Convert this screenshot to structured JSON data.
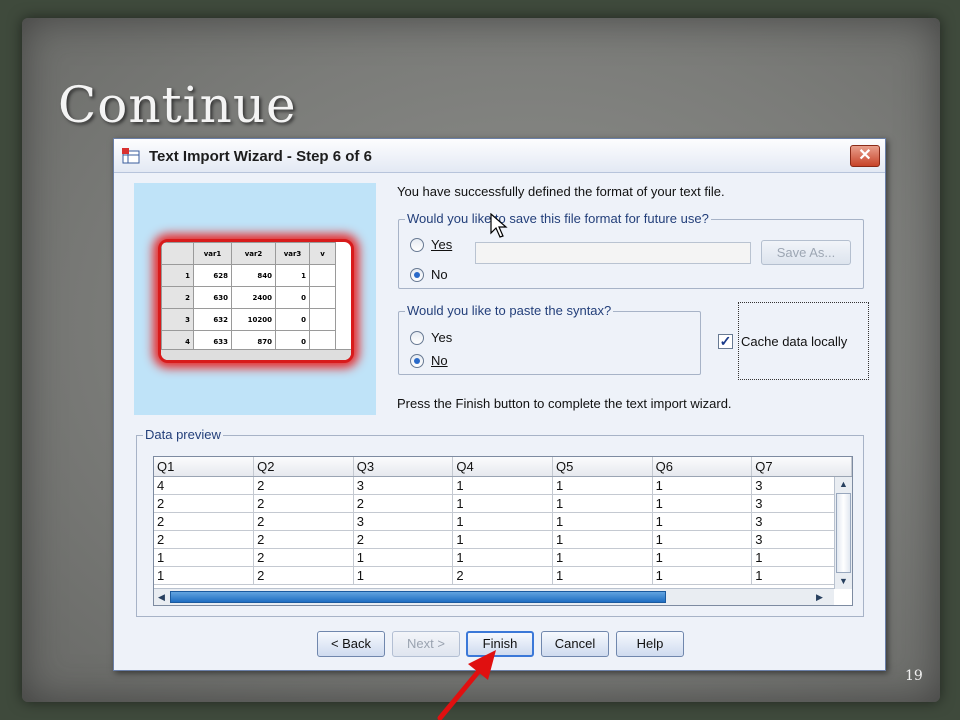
{
  "slide": {
    "title": "Continue",
    "number": "19"
  },
  "dialog": {
    "title": "Text Import Wizard - Step 6 of 6",
    "close_icon": "close-icon",
    "illustration": {
      "headers": [
        "",
        "var1",
        "var2",
        "var3",
        "v"
      ],
      "rows": [
        [
          "1",
          "628",
          "840",
          "1"
        ],
        [
          "2",
          "630",
          "2400",
          "0"
        ],
        [
          "3",
          "632",
          "10200",
          "0"
        ],
        [
          "4",
          "633",
          "870",
          "0"
        ]
      ]
    },
    "success_message": "You have successfully defined the format of your text file.",
    "save_format": {
      "legend": "Would you like to save this file format for future use?",
      "yes_label": "Yes",
      "no_label": "No",
      "selected": "No",
      "file_name": "",
      "save_as_label": "Save As..."
    },
    "paste_syntax": {
      "legend": "Would you like to paste the syntax?",
      "yes_label": "Yes",
      "no_label": "No",
      "selected": "No"
    },
    "cache": {
      "label": "Cache data locally",
      "checked": true
    },
    "finish_instruction": "Press the Finish button to complete the text import wizard.",
    "data_preview": {
      "legend": "Data preview",
      "columns": [
        "Q1",
        "Q2",
        "Q3",
        "Q4",
        "Q5",
        "Q6",
        "Q7"
      ],
      "rows": [
        [
          "4",
          "2",
          "3",
          "1",
          "1",
          "1",
          "3"
        ],
        [
          "2",
          "2",
          "2",
          "1",
          "1",
          "1",
          "3"
        ],
        [
          "2",
          "2",
          "3",
          "1",
          "1",
          "1",
          "3"
        ],
        [
          "2",
          "2",
          "2",
          "1",
          "1",
          "1",
          "3"
        ],
        [
          "1",
          "2",
          "1",
          "1",
          "1",
          "1",
          "1"
        ],
        [
          "1",
          "2",
          "1",
          "2",
          "1",
          "1",
          "1"
        ]
      ]
    },
    "buttons": {
      "back": "< Back",
      "next": "Next >",
      "finish": "Finish",
      "cancel": "Cancel",
      "help": "Help"
    }
  },
  "colors": {
    "highlight_arrow": "#e01010",
    "dialog_accent": "#233f7a"
  }
}
